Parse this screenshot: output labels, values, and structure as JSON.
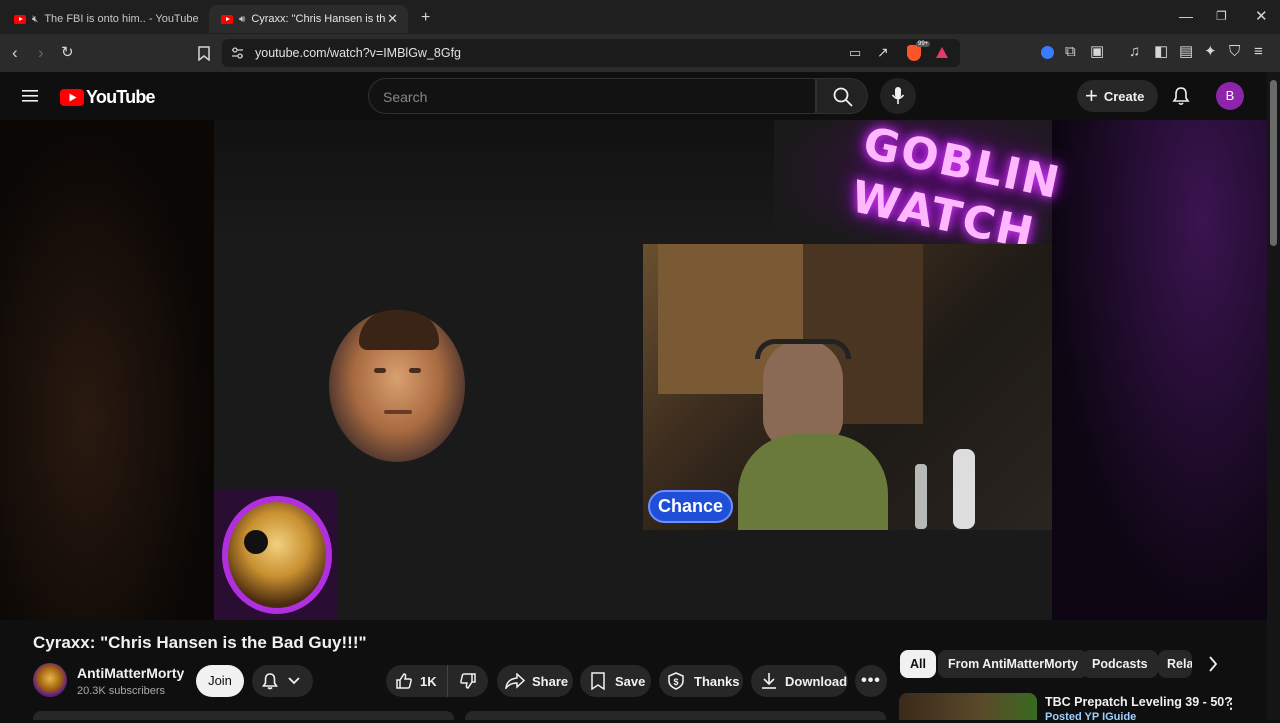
{
  "browser": {
    "tabs": [
      {
        "label": "The FBI is onto him.. - YouTube",
        "muted": true
      },
      {
        "label": "Cyraxx: \"Chris Hansen is the B",
        "playing": true,
        "active": true
      }
    ],
    "url": "youtube.com/watch?v=IMBlGw_8Gfg",
    "badge": "99+"
  },
  "header": {
    "logo_text": "YouTube",
    "search_placeholder": "Search",
    "create_label": "Create",
    "avatar_letter": "B"
  },
  "video": {
    "overlay_title_1": "GOBLIN",
    "overlay_title_2": "WATCH",
    "name_tag": "Chance"
  },
  "info": {
    "title": "Cyraxx: \"Chris Hansen is the Bad Guy!!!\"",
    "channel_name": "AntiMatterMorty",
    "subscribers": "20.3K subscribers",
    "join_label": "Join",
    "like_count": "1K",
    "share_label": "Share",
    "save_label": "Save",
    "thanks_label": "Thanks",
    "download_label": "Download"
  },
  "filters": {
    "chips": [
      "All",
      "From AntiMatterMorty",
      "Podcasts",
      "Rela"
    ]
  },
  "recommended": {
    "title": "TBC Prepatch Leveling 39 - 50?",
    "subtitle": "Posted YP IGuide"
  },
  "colors": {
    "accent": "#ff0000",
    "avatar": "#8e24aa",
    "name_tag": "#1f4fd8",
    "neon": "#e040fb"
  }
}
